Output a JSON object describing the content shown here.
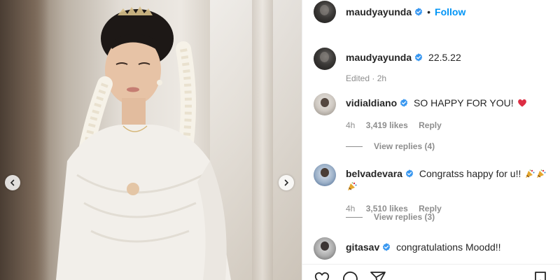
{
  "post": {
    "author": "maudyayunda",
    "follow_label": "Follow",
    "separator": "•"
  },
  "caption": {
    "author": "maudyayunda",
    "text": "22.5.22",
    "edited": "Edited",
    "time": "2h"
  },
  "comments": [
    {
      "username": "vidialdiano",
      "text": "SO HAPPY FOR YOU!",
      "emoji": "heart",
      "time": "4h",
      "likes": "3,419 likes",
      "reply_label": "Reply",
      "view_replies": "View replies (4)"
    },
    {
      "username": "belvadevara",
      "text": "Congratss happy for u!!",
      "emoji": "party-popper",
      "time": "4h",
      "likes": "3,510 likes",
      "reply_label": "Reply",
      "view_replies": "View replies (3)"
    },
    {
      "username": "gitasav",
      "text": "congratulations Moodd!!"
    }
  ],
  "icons": {
    "carousel_prev": "chevron-left-icon",
    "carousel_next": "chevron-right-icon",
    "verified": "verified-badge-icon",
    "like": "heart-outline-icon",
    "comment": "comment-icon",
    "share": "paper-plane-icon",
    "save": "bookmark-icon"
  },
  "colors": {
    "accent": "#0095f6",
    "verified": "#3897f0",
    "heart": "#ed4956",
    "secondary_text": "#8e8e8e"
  }
}
